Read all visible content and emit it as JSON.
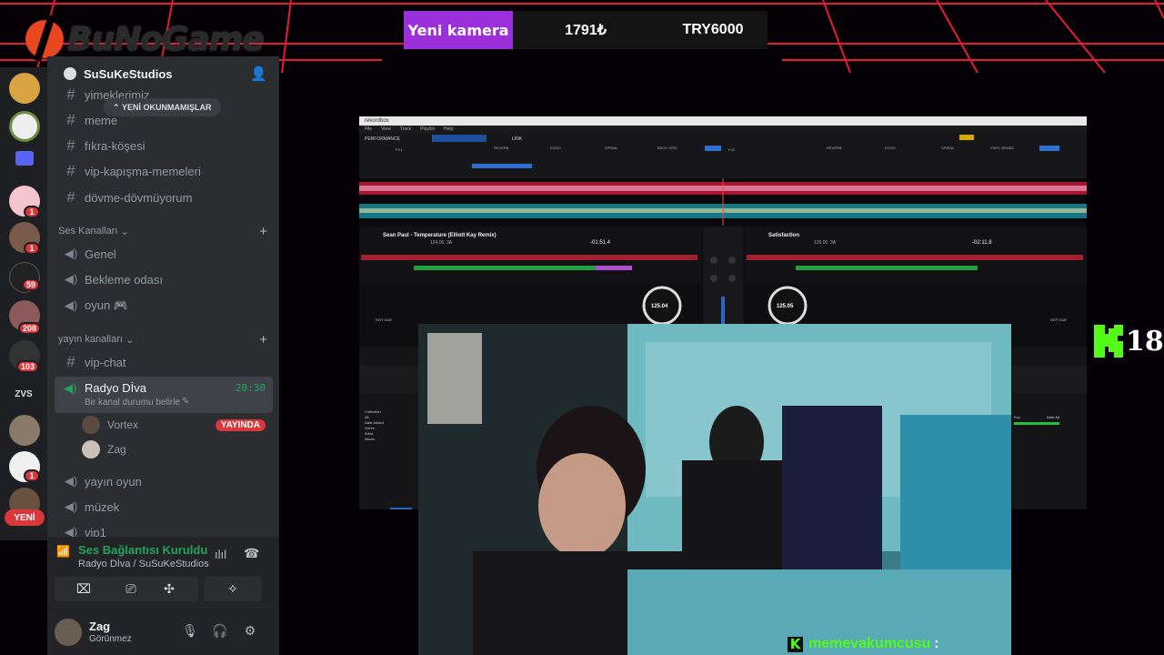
{
  "overlay": {
    "logo_text": "BuNoGame",
    "donation": {
      "label": "Yeni kamera",
      "amount": "1791₺",
      "goal": "TRY6000"
    },
    "age_rating": "18",
    "chat": {
      "username": "memevakumcusu",
      "separator": ":"
    },
    "colors": {
      "grid_red": "#ff1e3c",
      "donation_purple": "#9b2fd9",
      "kick_green": "#53fc18"
    }
  },
  "server_rail": {
    "badges": [
      "1",
      "1",
      "59",
      "208",
      "103",
      "1"
    ],
    "server_label": "ZVS",
    "new_label": "YENİ"
  },
  "sidebar": {
    "server_name": "SuSuKeStudios",
    "unread_pill": "YENİ OKUNMAMIŞLAR",
    "text_channels": [
      "yimeklerimiz",
      "meme",
      "fıkra-köşesi",
      "vip-kapışma-memeleri",
      "dövme-dövmüyorum"
    ],
    "voice_category": "Ses Kanalları",
    "voice_channels": [
      "Genel",
      "Bekleme odası",
      "oyun 🎮"
    ],
    "stream_category": "yayın kanalları",
    "stream_text_channel": "vip-chat",
    "active_channel": {
      "name": "Radyo Dİva",
      "time": "20:30",
      "status_placeholder": "Bir kanal durumu belirle"
    },
    "voice_users": [
      {
        "name": "Vortex",
        "live": "YAYINDA"
      },
      {
        "name": "Zag",
        "live": ""
      }
    ],
    "more_channels": [
      "yayın oyun",
      "müzek",
      "vip1"
    ]
  },
  "voice_panel": {
    "status": "Ses Bağlantısı Kuruldu",
    "channel": "Radyo Dİva / SuSuKeStudios"
  },
  "user_panel": {
    "name": "Zag",
    "status": "Görünmez"
  },
  "rekordbox": {
    "app_title": "rekordbox",
    "menu": [
      "File",
      "View",
      "Track",
      "Playlist",
      "Help"
    ],
    "mode": "PERFORMANCE",
    "link_label": "LINK",
    "fx_labels": [
      "FX1",
      "REVERB",
      "ECHO",
      "SPIRAL",
      "BACK SPIN",
      "FX2",
      "REVERB",
      "ECHO",
      "SPIRAL",
      "VINYL BRAKE"
    ],
    "deck1": {
      "title": "Sean Paul - Temperature (Elliott Kay Remix)",
      "bpm": "124.00",
      "key": "3A",
      "time": "-01:51.4",
      "knob_bpm": "125.04"
    },
    "deck2": {
      "title": "Satisfaction",
      "bpm": "126.00",
      "key": "3A",
      "time": "-02:11.8",
      "knob_bpm": "125.05"
    },
    "deck_buttons": [
      "HOT CUE",
      "KEY SYNC",
      "BEAT SYNC",
      "MASTER",
      "CUE",
      "STEM"
    ],
    "tree": [
      "Collection",
      "All",
      "Date Added",
      "Genre",
      "Artist",
      "Album"
    ],
    "browser_right": [
      "Key",
      "Date Ad"
    ],
    "footer_logo": "rekordbox"
  }
}
